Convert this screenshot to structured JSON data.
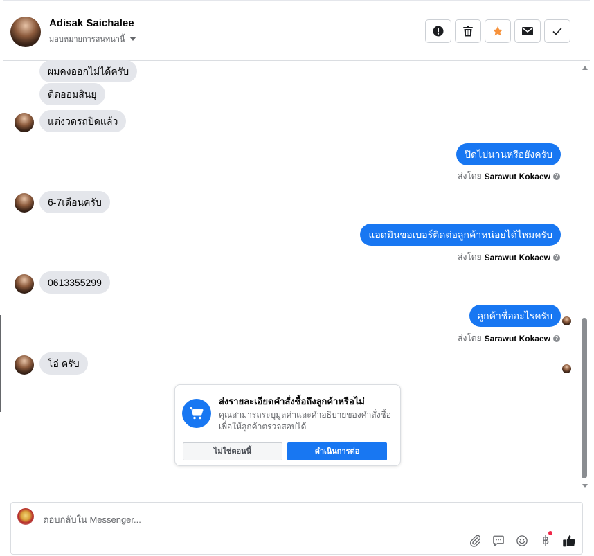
{
  "header": {
    "contact_name": "Adisak Saichalee",
    "assign_label": "มอบหมายการสนทนานี้",
    "actions": [
      {
        "name": "report-button",
        "icon": "exclamation-icon"
      },
      {
        "name": "delete-button",
        "icon": "trash-icon"
      },
      {
        "name": "follow-up-button",
        "icon": "star-icon",
        "color": "#f7923b"
      },
      {
        "name": "mark-unread-button",
        "icon": "envelope-icon"
      },
      {
        "name": "mark-done-button",
        "icon": "check-icon"
      }
    ]
  },
  "messages": [
    {
      "direction": "in",
      "text": "ผมคงออกไม่ได้ครับ"
    },
    {
      "direction": "in",
      "text": "ติดออมสินยุ"
    },
    {
      "direction": "in",
      "text": "แต่งวดรถปิดแล้ว"
    },
    {
      "direction": "out",
      "text": "ปิดไปนานหรือยังครับ",
      "sent_by_prefix": "ส่งโดย",
      "sent_by_name": "Sarawut Kokaew"
    },
    {
      "direction": "in",
      "text": "6-7เดือนครับ"
    },
    {
      "direction": "out",
      "text": "แอดมินขอเบอร์ติดต่อลูกค้าหน่อยได้ไหมครับ",
      "sent_by_prefix": "ส่งโดย",
      "sent_by_name": "Sarawut Kokaew"
    },
    {
      "direction": "in",
      "text": "0613355299"
    },
    {
      "direction": "out",
      "text": "ลูกค้าชื่ออะไรครับ",
      "sent_by_prefix": "ส่งโดย",
      "sent_by_name": "Sarawut Kokaew"
    },
    {
      "direction": "in",
      "text": "โอ่ ครับ"
    }
  ],
  "order_prompt": {
    "title": "ส่งรายละเอียดคำสั่งซื้อถึงลูกค้าหรือไม่",
    "description": "คุณสามารถระบุมูลค่าและคำอธิบายของคำสั่งซื้อเพื่อให้ลูกค้าตรวจสอบได้",
    "decline_label": "ไม่ใช่ตอนนี้",
    "accept_label": "ดำเนินการต่อ",
    "icon": "shopping-cart-icon"
  },
  "composer": {
    "placeholder": "ตอบกลับใน Messenger...",
    "tools": [
      "attachment-icon",
      "saved-replies-icon",
      "emoji-icon",
      "baht-icon",
      "thumbs-up-icon"
    ]
  },
  "colors": {
    "accent": "#1877f2",
    "incoming_bubble": "#e4e6eb",
    "star": "#f7923b",
    "notification": "#f02849"
  }
}
